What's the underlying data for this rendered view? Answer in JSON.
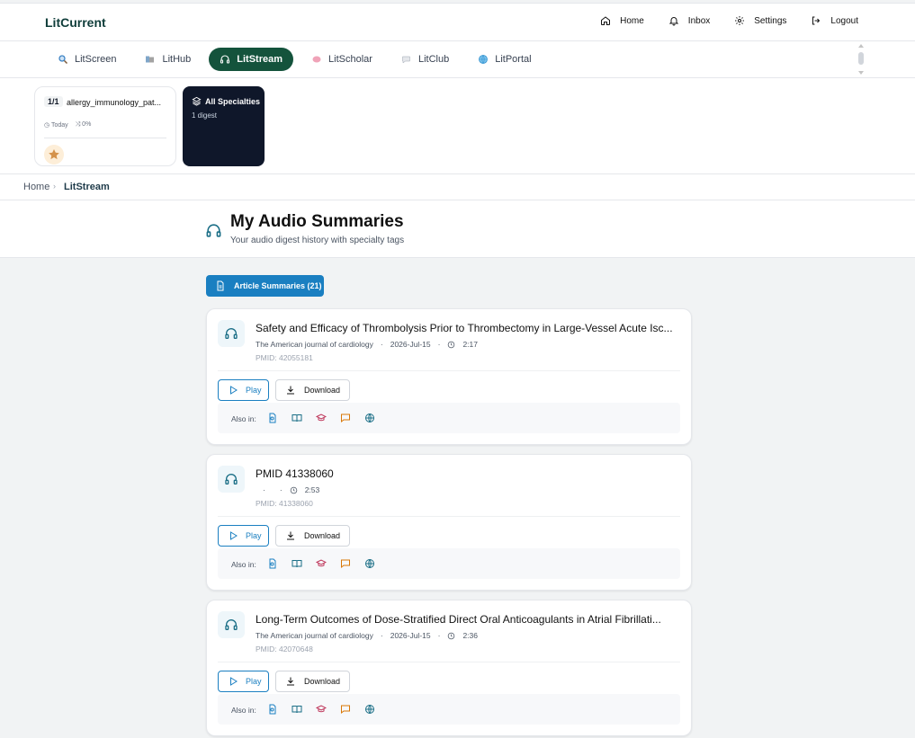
{
  "brand": "LitCurrent",
  "topnav": [
    {
      "label": "Home"
    },
    {
      "label": "Inbox"
    },
    {
      "label": "Settings"
    },
    {
      "label": "Logout"
    }
  ],
  "apps": [
    {
      "label": "LitScreen",
      "active": false
    },
    {
      "label": "LitHub",
      "active": false
    },
    {
      "label": "LitStream",
      "active": true
    },
    {
      "label": "LitScholar",
      "active": false
    },
    {
      "label": "LitClub",
      "active": false
    },
    {
      "label": "LitPortal",
      "active": false
    }
  ],
  "digest": {
    "count": "1/1",
    "name": "allergy_immunology_pat...",
    "date": "Today",
    "progress": "0%",
    "all_title": "All Specialties",
    "all_sub": "1 digest"
  },
  "breadcrumb": {
    "home": "Home",
    "current": "LitStream"
  },
  "header": {
    "title": "My Audio Summaries",
    "subtitle": "Your audio digest history with specialty tags"
  },
  "summaries_button": "Article Summaries (21)",
  "labels": {
    "play": "Play",
    "download": "Download",
    "also_in": "Also in:"
  },
  "cards": [
    {
      "title": "Safety and Efficacy of Thrombolysis Prior to Thrombectomy in Large-Vessel Acute Isc...",
      "journal": "The American journal of cardiology",
      "date": "2026-Jul-15",
      "duration": "2:17",
      "pmid": "PMID: 42055181"
    },
    {
      "title": "PMID 41338060",
      "journal": "",
      "date": "",
      "duration": "2:53",
      "pmid": "PMID: 41338060"
    },
    {
      "title": "Long-Term Outcomes of Dose-Stratified Direct Oral Anticoagulants in Atrial Fibrillati...",
      "journal": "The American journal of cardiology",
      "date": "2026-Jul-15",
      "duration": "2:36",
      "pmid": "PMID: 42070648"
    }
  ],
  "colors": {
    "accent": "#1a7fc1",
    "active_tab": "#14533c",
    "dark_card": "#0f172a"
  }
}
